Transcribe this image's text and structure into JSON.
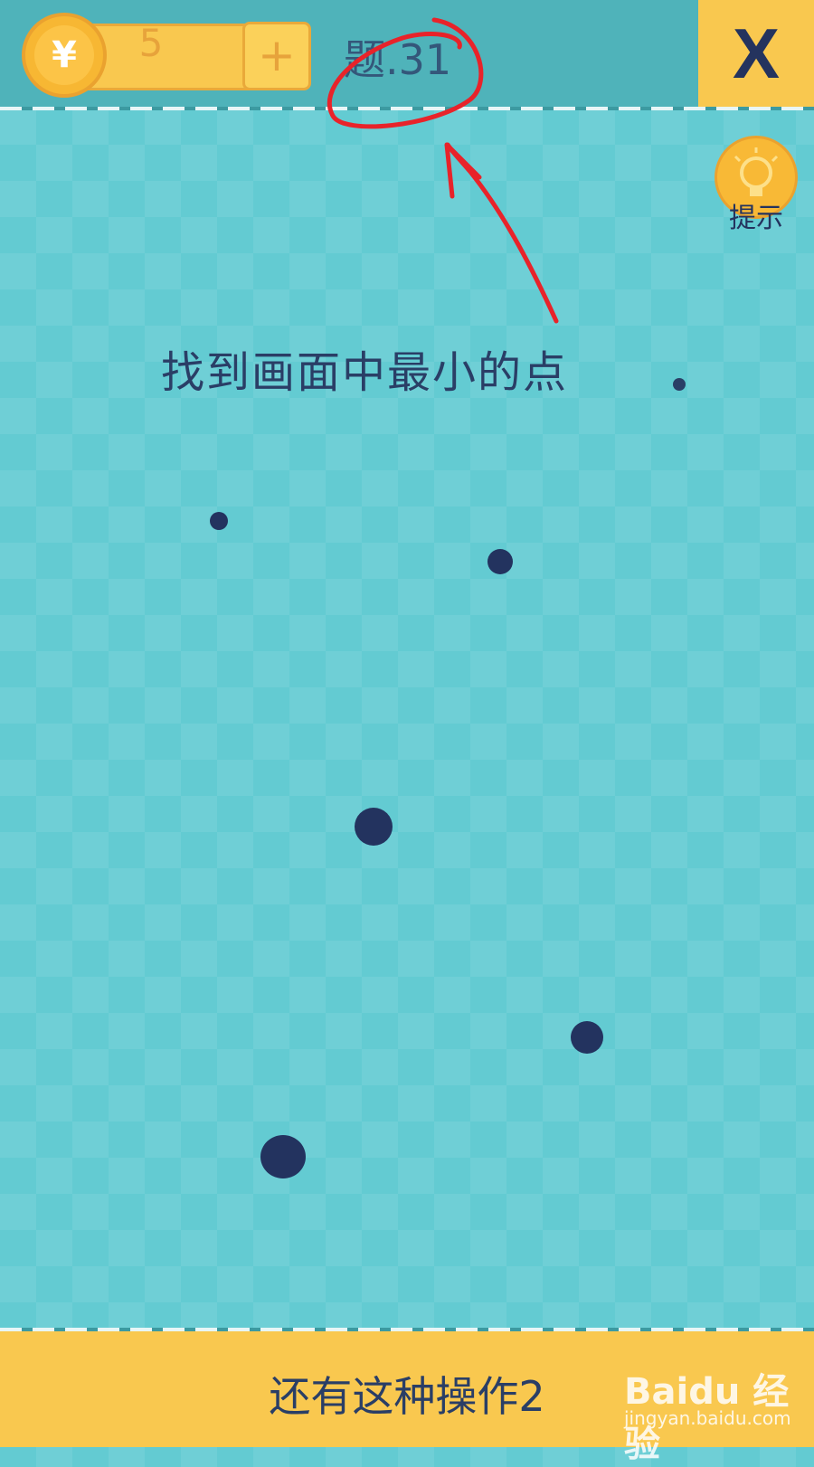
{
  "header": {
    "coin_symbol": "¥",
    "coin_count": "5",
    "add_coins_label": "+",
    "level_label": "题.31",
    "close_label": "X"
  },
  "hint": {
    "label": "提示"
  },
  "puzzle": {
    "instruction": "找到画面中最小的点"
  },
  "footer": {
    "level_name": "还有这种操作2"
  },
  "watermark": {
    "brand": "Baidu 经验",
    "url": "jingyan.baidu.com"
  },
  "colors": {
    "background": "#63cbd2",
    "header": "#4fb3ba",
    "accent_yellow": "#f9c84f",
    "dot": "#23335f",
    "annotation_red": "#e8232a"
  },
  "icons": {
    "coin": "yen-coin-icon",
    "add": "plus-icon",
    "close": "close-icon",
    "hint": "lightbulb-icon"
  }
}
